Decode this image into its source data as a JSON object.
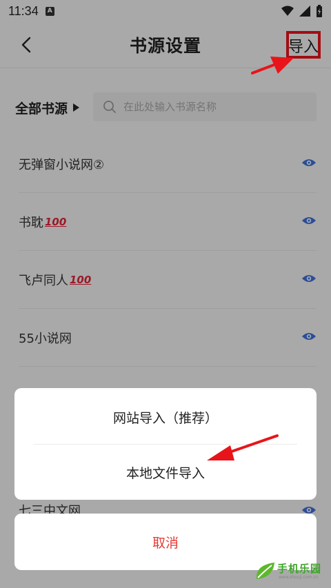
{
  "status_bar": {
    "time": "11:34",
    "badge": "A"
  },
  "header": {
    "title": "书源设置",
    "import_label": "导入"
  },
  "filter": {
    "all_label": "全部书源",
    "search_placeholder": "在此处输入书源名称"
  },
  "sources": [
    {
      "name": "无弹窗小说网②",
      "suffix": ""
    },
    {
      "name": "书耽",
      "suffix": "100"
    },
    {
      "name": "飞卢同人",
      "suffix": "100"
    },
    {
      "name": "55小说网",
      "suffix": ""
    }
  ],
  "partial_rows": [
    "七三中文网"
  ],
  "sheet": {
    "option_web": "网站导入（推荐）",
    "option_local": "本地文件导入",
    "cancel": "取消"
  },
  "watermark": {
    "main": "手机乐园",
    "sub": "www.shouji.com.cn"
  },
  "colors": {
    "eye": "#3f6fd6",
    "cancel": "#e53935",
    "arrow": "#e8141a"
  }
}
